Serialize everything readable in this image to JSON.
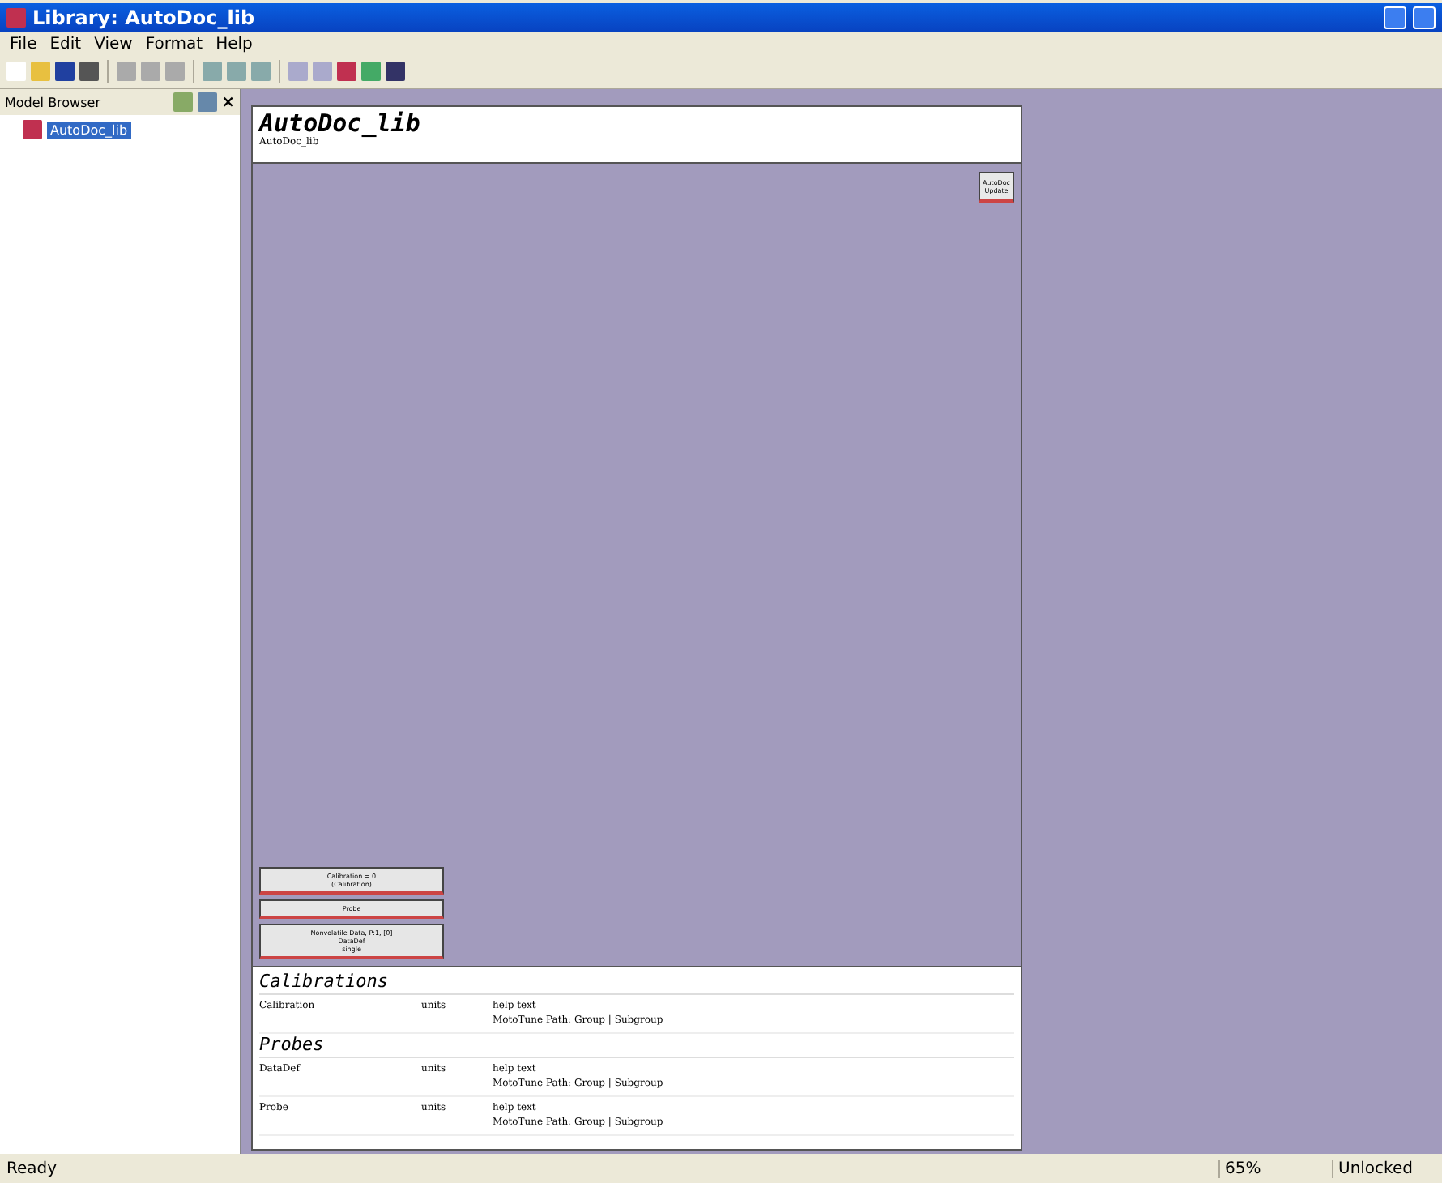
{
  "window": {
    "title": "Library: AutoDoc_lib"
  },
  "menu": [
    "File",
    "Edit",
    "View",
    "Format",
    "Help"
  ],
  "browser": {
    "title": "Model Browser",
    "close": "×",
    "items": [
      {
        "label": "AutoDoc_lib",
        "selected": true
      }
    ]
  },
  "diagram": {
    "title": "AutoDoc_lib",
    "subtitle": "AutoDoc_lib",
    "update_block": [
      "AutoDoc",
      "Update"
    ],
    "blocks": [
      {
        "lines": [
          "Calibration = 0",
          "(Calibration)"
        ]
      },
      {
        "lines": [
          "Probe"
        ]
      },
      {
        "lines": [
          "Nonvolatile Data, P:1, [0]",
          "DataDef",
          "single"
        ]
      }
    ],
    "sections": [
      {
        "title": "Calibrations",
        "rows": [
          {
            "name": "Calibration",
            "units": "units",
            "help": "help text",
            "path_label": "MotoTune Path:",
            "path": "Group | Subgroup"
          }
        ]
      },
      {
        "title": "Probes",
        "rows": [
          {
            "name": "DataDef",
            "units": "units",
            "help": "help text",
            "path_label": "MotoTune Path:",
            "path": "Group | Subgroup"
          },
          {
            "name": "Probe",
            "units": "units",
            "help": "help text",
            "path_label": "MotoTune Path:",
            "path": "Group | Subgroup"
          }
        ]
      }
    ]
  },
  "status_bar": {
    "message": "Ready",
    "zoom": "65%",
    "lock": "Unlocked"
  }
}
